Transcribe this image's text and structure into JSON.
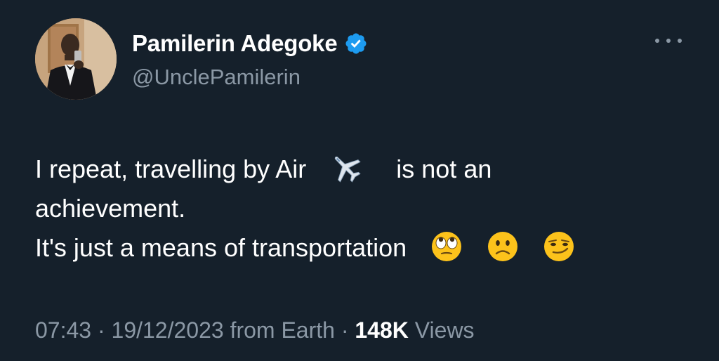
{
  "author": {
    "display_name": "Pamilerin Adegoke",
    "handle": "@UnclePamilerin",
    "verified": true,
    "avatar_icon": "avatar-photo"
  },
  "tweet": {
    "line1_before": "I repeat, travelling by Air",
    "line1_emoji": "airplane-emoji",
    "line1_after": "is not an",
    "line2": "achievement.",
    "line3": "It's just a means of transportation",
    "line3_emojis": [
      "face-with-rolling-eyes-emoji",
      "slightly-frowning-face-emoji",
      "smirking-face-emoji"
    ]
  },
  "meta": {
    "time": "07:43",
    "separator1": " · ",
    "date": "19/12/2023",
    "source": " from Earth",
    "separator2": " · ",
    "views_count": "148K",
    "views_label": " Views"
  },
  "colors": {
    "background": "#15202b",
    "text": "#ffffff",
    "secondary": "#8b98a5",
    "verified_blue": "#1d9bf0"
  }
}
